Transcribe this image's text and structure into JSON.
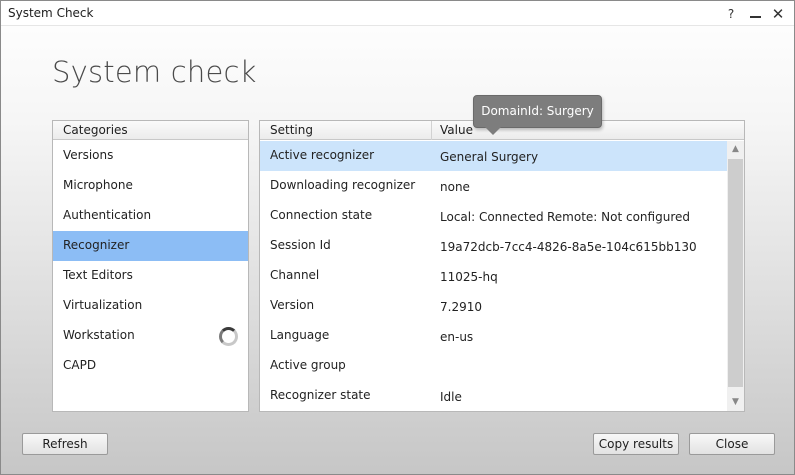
{
  "window": {
    "title": "System Check",
    "help_label": "?",
    "close_label": "✕"
  },
  "page": {
    "title": "System check"
  },
  "categories": {
    "header": "Categories",
    "items": [
      {
        "label": "Versions"
      },
      {
        "label": "Microphone"
      },
      {
        "label": "Authentication"
      },
      {
        "label": "Recognizer"
      },
      {
        "label": "Text Editors"
      },
      {
        "label": "Virtualization"
      },
      {
        "label": "Workstation"
      },
      {
        "label": "CAPD"
      }
    ],
    "selected": "Recognizer"
  },
  "settings": {
    "columns": [
      "Setting",
      "Value"
    ],
    "rows": [
      {
        "setting": "Active recognizer",
        "value": "General Surgery",
        "value2": ""
      },
      {
        "setting": "Downloading recognizer",
        "value": "none",
        "value2": ""
      },
      {
        "setting": "Connection state",
        "value": "Local: Connected",
        "value2": "Remote: Not configured"
      },
      {
        "setting": "Session Id",
        "value": "19a72dcb-7cc4-4826-8a5e-104c615bb130",
        "value2": ""
      },
      {
        "setting": "Channel",
        "value": "11025-hq",
        "value2": ""
      },
      {
        "setting": "Version",
        "value": "7.2910",
        "value2": ""
      },
      {
        "setting": "Language",
        "value": "en-us",
        "value2": ""
      },
      {
        "setting": "Active group",
        "value": "",
        "value2": ""
      },
      {
        "setting": "Recognizer state",
        "value": "Idle",
        "value2": ""
      }
    ]
  },
  "tooltip": {
    "text": "DomainId: Surgery"
  },
  "buttons": {
    "refresh": "Refresh",
    "copy_results": "Copy results",
    "close": "Close"
  },
  "colors": {
    "selected_category": "#8cbdf5",
    "selected_row": "#cce4fb",
    "tooltip_bg": "#7d7d7d"
  }
}
